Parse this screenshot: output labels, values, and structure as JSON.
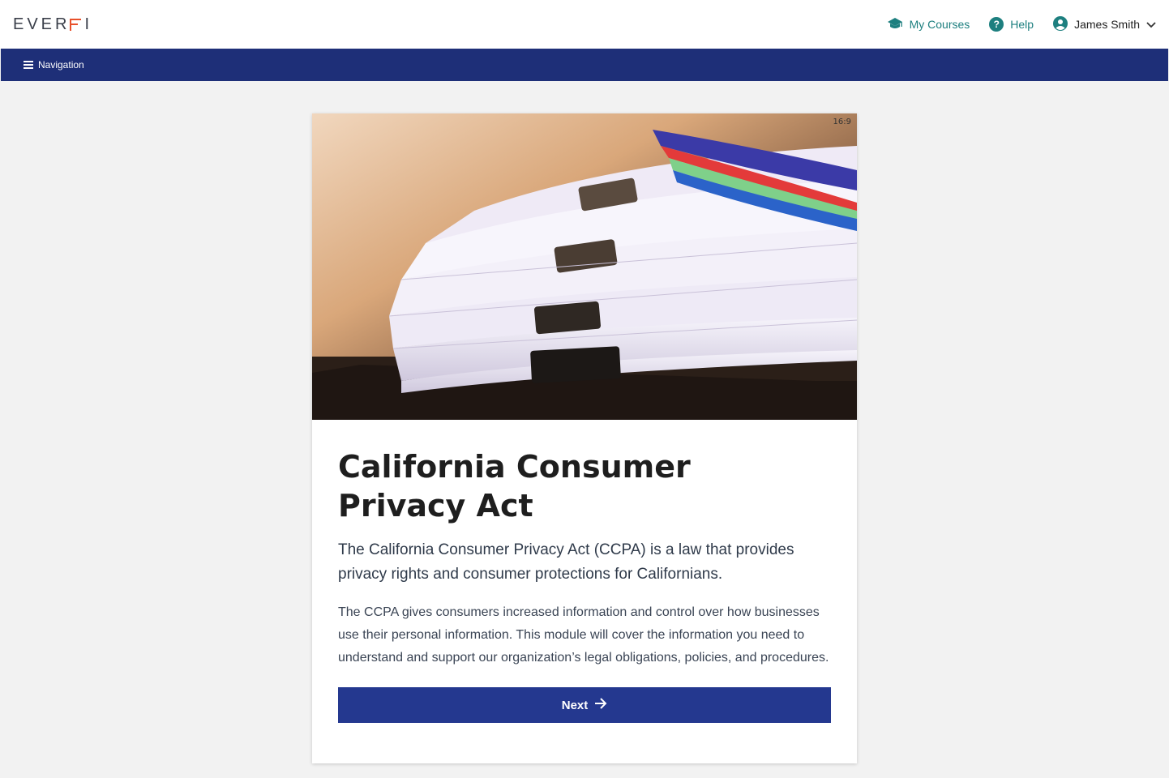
{
  "header": {
    "logo_text_1": "EVER",
    "logo_text_2": "I",
    "my_courses_label": "My Courses",
    "help_label": "Help",
    "user_name": "James Smith"
  },
  "navbar": {
    "navigation_label": "Navigation"
  },
  "card": {
    "aspect_ratio_label": "16:9",
    "hero_image_alt": "Stack of paper documents with binder clips",
    "title": "California Consumer Privacy Act",
    "lead": "The California Consumer Privacy Act (CCPA) is a law that provides privacy rights and consumer protections for Californians.",
    "description": "The CCPA gives consumers increased information and control over how businesses use their personal information. This module will cover the information you need to understand and support our organization’s legal obligations, policies, and procedures.",
    "next_label": "Next"
  },
  "colors": {
    "brand_teal": "#1d7f7f",
    "nav_blue": "#1e2f78",
    "button_blue": "#24388f",
    "logo_accent": "#e8502a"
  },
  "icons": {
    "my_courses": "graduation-cap-icon",
    "help": "help-circle-icon",
    "user": "user-circle-icon",
    "dropdown": "chevron-down-icon",
    "navigation": "hamburger-menu-icon",
    "next": "arrow-right-icon"
  }
}
